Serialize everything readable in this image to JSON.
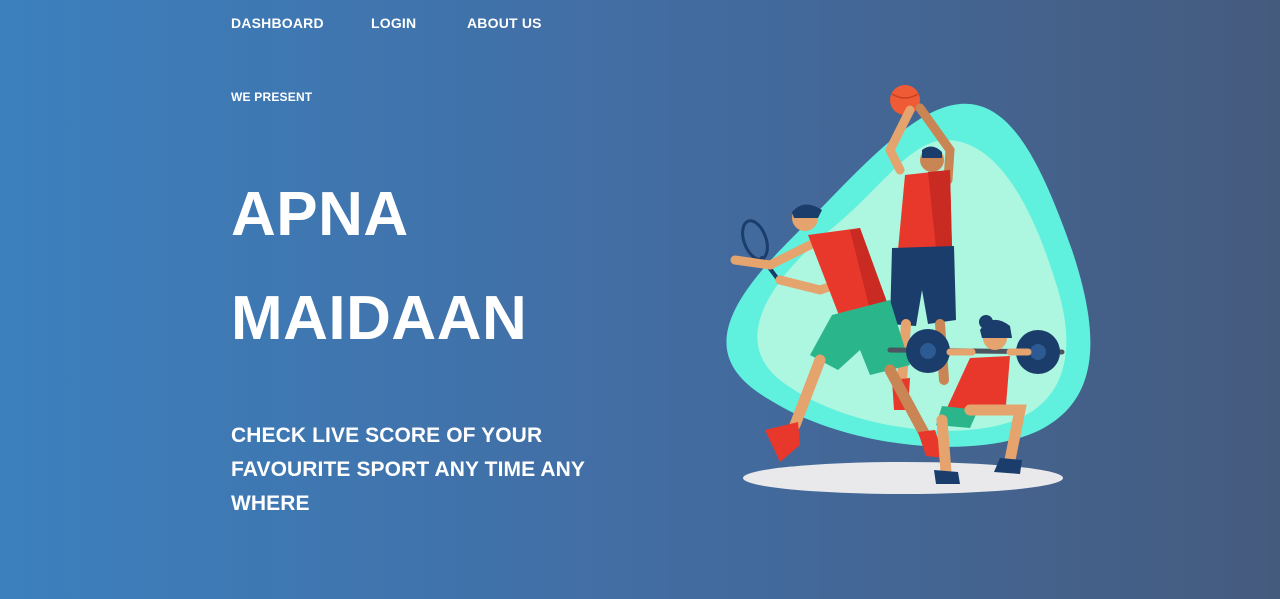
{
  "nav": {
    "items": [
      {
        "label": "DASHBOARD"
      },
      {
        "label": "LOGIN"
      },
      {
        "label": "ABOUT US"
      }
    ]
  },
  "hero": {
    "eyebrow": "WE PRESENT",
    "title_line1": "APNA",
    "title_line2": "MAIDAAN",
    "tagline": "CHECK LIVE SCORE OF YOUR FAVOURITE SPORT ANY TIME ANY WHERE"
  },
  "colors": {
    "gradient_start": "#3c80be",
    "gradient_end": "#455b7e",
    "text": "#ffffff",
    "illustration_teal": "#5ff0de",
    "illustration_mint": "#adf6df",
    "accent_red": "#e8382c",
    "accent_navy": "#1b3d6b"
  },
  "illustration": {
    "icon": "sports-players-illustration"
  }
}
